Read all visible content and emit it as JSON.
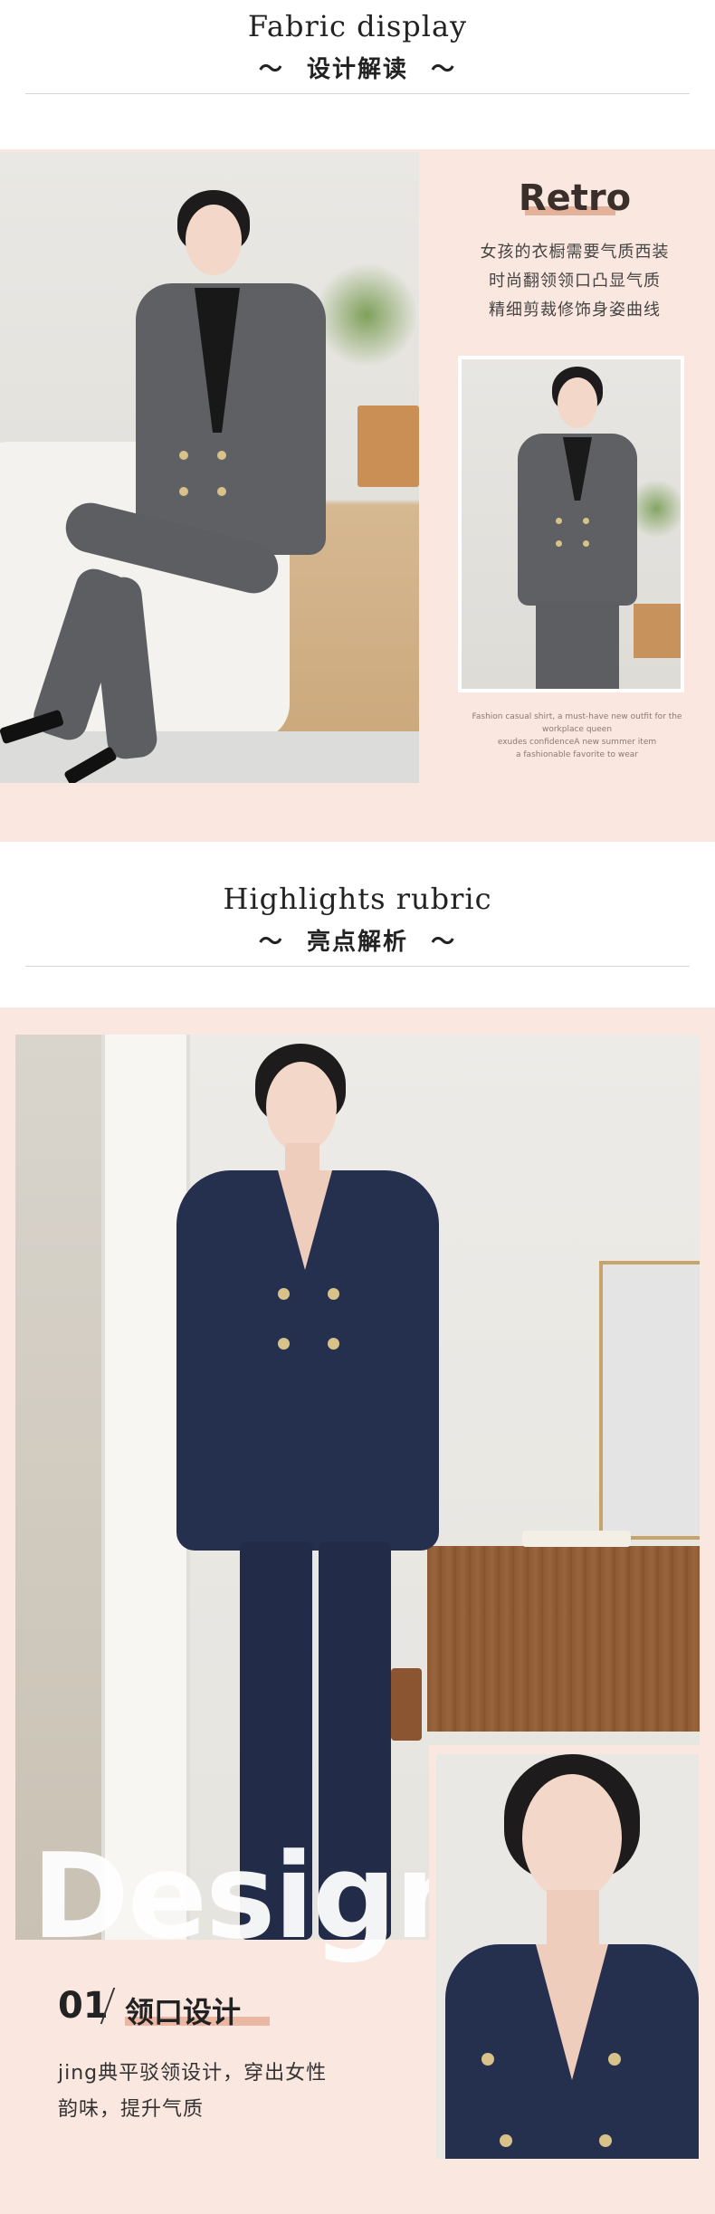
{
  "sections": {
    "fabric": {
      "title_en": "Fabric display",
      "title_cn": "设计解读",
      "retro_title": "Retro",
      "lines": [
        "女孩的衣橱需要气质西装",
        "时尚翻领领口凸显气质",
        "精细剪裁修饰身姿曲线"
      ],
      "caption": [
        "Fashion casual shirt, a must-have new outfit for the",
        "workplace queen",
        "exudes confidenceA new summer item",
        "a fashionable favorite to wear"
      ]
    },
    "highlights": {
      "title_en": "Highlights rubric",
      "title_cn": "亮点解析",
      "overlay_word": "Design",
      "number": "01",
      "feature_title": "领口设计",
      "desc_lines": [
        "jing典平驳领设计，穿出女性",
        "韵味，提升气质"
      ]
    }
  },
  "ornament": "〜",
  "colors": {
    "peach_bg": "#fae7e0",
    "accent_underline": "#e4b19b",
    "grey_suit": "#5f6063",
    "navy_suit": "#25304f"
  }
}
